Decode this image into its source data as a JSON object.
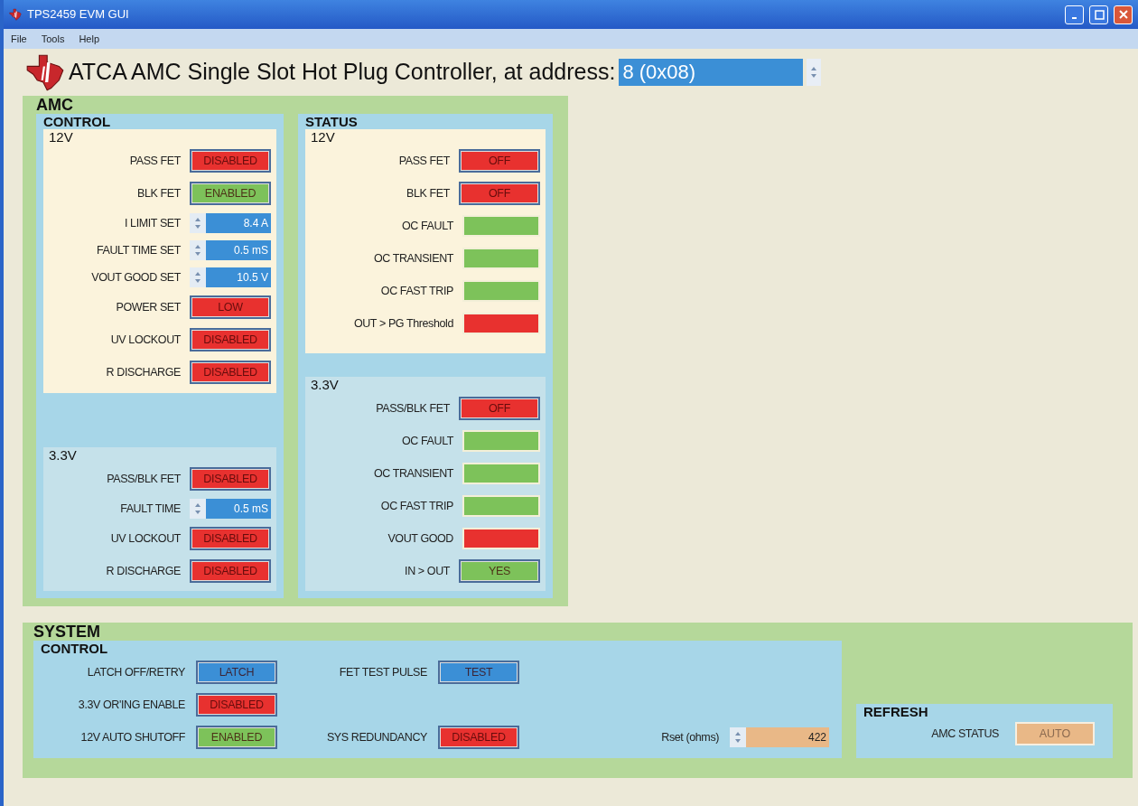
{
  "window": {
    "title": "TPS2459 EVM GUI"
  },
  "menu": [
    {
      "label": "File"
    },
    {
      "label": "Tools"
    },
    {
      "label": "Help"
    }
  ],
  "header": {
    "title": "ATCA AMC Single Slot Hot Plug Controller, at address:",
    "address": "8 (0x08)"
  },
  "amc": {
    "title": "AMC",
    "control": {
      "title": "CONTROL",
      "groups": [
        {
          "title": "12V",
          "rows": [
            {
              "label": "PASS FET",
              "kind": "toggle",
              "value": "DISABLED",
              "color": "#e8312f"
            },
            {
              "label": "BLK FET",
              "kind": "toggle",
              "value": "ENABLED",
              "color": "#7dc25a"
            },
            {
              "label": "I LIMIT SET",
              "kind": "spin",
              "value": "8.4 A",
              "color": "#3b8fd6"
            },
            {
              "label": "FAULT TIME SET",
              "kind": "spin",
              "value": "0.5 mS",
              "color": "#3b8fd6"
            },
            {
              "label": "VOUT GOOD SET",
              "kind": "spin",
              "value": "10.5 V",
              "color": "#3b8fd6"
            },
            {
              "label": "POWER SET",
              "kind": "toggle",
              "value": "LOW",
              "color": "#e8312f"
            },
            {
              "label": "UV LOCKOUT",
              "kind": "toggle",
              "value": "DISABLED",
              "color": "#e8312f"
            },
            {
              "label": "R DISCHARGE",
              "kind": "toggle",
              "value": "DISABLED",
              "color": "#e8312f"
            }
          ]
        },
        {
          "title": "3.3V",
          "rows": [
            {
              "label": "PASS/BLK FET",
              "kind": "toggle",
              "value": "DISABLED",
              "color": "#e8312f"
            },
            {
              "label": "FAULT TIME",
              "kind": "spin",
              "value": "0.5 mS",
              "color": "#3b8fd6"
            },
            {
              "label": "UV LOCKOUT",
              "kind": "toggle",
              "value": "DISABLED",
              "color": "#e8312f"
            },
            {
              "label": "R DISCHARGE",
              "kind": "toggle",
              "value": "DISABLED",
              "color": "#e8312f"
            }
          ]
        }
      ]
    },
    "status": {
      "title": "STATUS",
      "groups": [
        {
          "title": "12V",
          "rows": [
            {
              "label": "PASS FET",
              "kind": "toggle",
              "value": "OFF",
              "color": "#e8312f"
            },
            {
              "label": "BLK FET",
              "kind": "toggle",
              "value": "OFF",
              "color": "#e8312f"
            },
            {
              "label": "OC FAULT",
              "kind": "indicator",
              "color": "#7dc25a"
            },
            {
              "label": "OC TRANSIENT",
              "kind": "indicator",
              "color": "#7dc25a"
            },
            {
              "label": "OC FAST TRIP",
              "kind": "indicator",
              "color": "#7dc25a"
            },
            {
              "label": "OUT > PG Threshold",
              "kind": "indicator",
              "color": "#e8312f"
            }
          ]
        },
        {
          "title": "3.3V",
          "rows": [
            {
              "label": "PASS/BLK FET",
              "kind": "toggle",
              "value": "OFF",
              "color": "#e8312f"
            },
            {
              "label": "OC FAULT",
              "kind": "indicator",
              "color": "#7dc25a"
            },
            {
              "label": "OC TRANSIENT",
              "kind": "indicator",
              "color": "#7dc25a"
            },
            {
              "label": "OC FAST TRIP",
              "kind": "indicator",
              "color": "#7dc25a"
            },
            {
              "label": "VOUT GOOD",
              "kind": "indicator",
              "color": "#e8312f"
            },
            {
              "label": "IN > OUT",
              "kind": "toggle",
              "value": "YES",
              "color": "#7dc25a"
            }
          ]
        }
      ]
    }
  },
  "system": {
    "title": "SYSTEM",
    "control": {
      "title": "CONTROL",
      "rows": [
        {
          "left": {
            "label": "LATCH OFF/RETRY",
            "kind": "toggle",
            "value": "LATCH",
            "color": "#3b8fd6"
          },
          "right": {
            "label": "FET TEST PULSE",
            "kind": "toggle",
            "value": "TEST",
            "color": "#3b8fd6"
          }
        },
        {
          "left": {
            "label": "3.3V OR'ING ENABLE",
            "kind": "toggle",
            "value": "DISABLED",
            "color": "#e8312f"
          }
        },
        {
          "left": {
            "label": "12V AUTO SHUTOFF",
            "kind": "toggle",
            "value": "ENABLED",
            "color": "#7dc25a"
          },
          "right": {
            "label": "SYS REDUNDANCY",
            "kind": "toggle",
            "value": "DISABLED",
            "color": "#e8312f"
          }
        }
      ],
      "rset": {
        "label": "Rset (ohms)",
        "kind": "spin",
        "value": "422",
        "color": "#e9b887"
      }
    },
    "refresh": {
      "title": "REFRESH",
      "rows": [
        {
          "label": "AMC STATUS",
          "kind": "flat",
          "value": "AUTO",
          "color": "#e9b887"
        }
      ]
    }
  }
}
